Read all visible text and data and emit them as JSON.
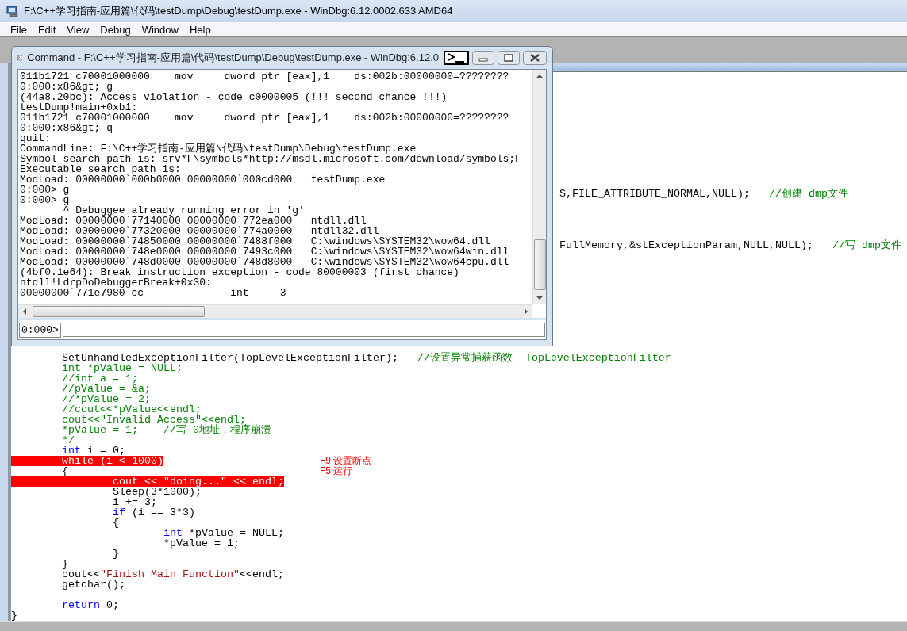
{
  "window": {
    "title": "F:\\C++学习指南-应用篇\\代码\\testDump\\Debug\\testDump.exe - WinDbg:6.12.0002.633 AMD64"
  },
  "menu": [
    "File",
    "Edit",
    "View",
    "Debug",
    "Window",
    "Help"
  ],
  "source": {
    "fragments": [
      {
        "segments": [
          {
            "kind": "code",
            "text": "S,FILE_ATTRIBUTE_NORMAL,NULL);   "
          },
          {
            "kind": "comment",
            "text": "//创建 dmp文件"
          }
        ]
      },
      {
        "segments": [
          {
            "kind": "code",
            "text": "FullMemory,&stExceptionParam,NULL,NULL);   "
          },
          {
            "kind": "comment",
            "text": "//写 dmp文件"
          }
        ]
      }
    ],
    "lines": [
      {
        "segments": [
          {
            "kind": "code",
            "text": "        SetUnhandledExceptionFilter(TopLevelExceptionFilter);   "
          },
          {
            "kind": "comment",
            "text": "//设置异常捕获函数  TopLevelExceptionFilter"
          }
        ],
        "breakpoint": false
      },
      {
        "segments": [
          {
            "kind": "comment",
            "text": "        int *pValue = NULL;"
          }
        ],
        "breakpoint": false
      },
      {
        "segments": [
          {
            "kind": "comment",
            "text": "        //int a = 1;"
          }
        ],
        "breakpoint": false
      },
      {
        "segments": [
          {
            "kind": "comment",
            "text": "        //pValue = &a;"
          }
        ],
        "breakpoint": false
      },
      {
        "segments": [
          {
            "kind": "comment",
            "text": "        //*pValue = 2;"
          }
        ],
        "breakpoint": false
      },
      {
        "segments": [
          {
            "kind": "comment",
            "text": "        //cout<<*pValue<<endl;"
          }
        ],
        "breakpoint": false
      },
      {
        "segments": [
          {
            "kind": "comment",
            "text": "        cout<<\"Invalid Access\"<<endl;"
          }
        ],
        "breakpoint": false
      },
      {
        "segments": [
          {
            "kind": "comment",
            "text": "        *pValue = 1;    //写 0地址，程序崩溃"
          }
        ],
        "breakpoint": false
      },
      {
        "segments": [
          {
            "kind": "comment",
            "text": "        */"
          }
        ],
        "breakpoint": false
      },
      {
        "segments": [
          {
            "kind": "keyword",
            "text": "        int"
          },
          {
            "kind": "code",
            "text": " i = 0;"
          }
        ],
        "breakpoint": false
      },
      {
        "segments": [
          {
            "kind": "code",
            "text": "        while (i < 1000)"
          }
        ],
        "breakpoint": true,
        "note": "F9 设置断点"
      },
      {
        "segments": [
          {
            "kind": "code",
            "text": "        {"
          }
        ],
        "breakpoint": false,
        "note": "F5 运行"
      },
      {
        "segments": [
          {
            "kind": "code",
            "text": "                cout << \"doing...\" << endl;"
          }
        ],
        "breakpoint": true
      },
      {
        "segments": [
          {
            "kind": "code",
            "text": "                Sleep(3*1000);"
          }
        ],
        "breakpoint": false
      },
      {
        "segments": [
          {
            "kind": "code",
            "text": "                i += 3;"
          }
        ],
        "breakpoint": false
      },
      {
        "segments": [
          {
            "kind": "keyword",
            "text": "                if"
          },
          {
            "kind": "code",
            "text": " (i == 3*3)"
          }
        ],
        "breakpoint": false
      },
      {
        "segments": [
          {
            "kind": "code",
            "text": "                {"
          }
        ],
        "breakpoint": false
      },
      {
        "segments": [
          {
            "kind": "keyword",
            "text": "                        int"
          },
          {
            "kind": "code",
            "text": " *pValue = NULL;"
          }
        ],
        "breakpoint": false
      },
      {
        "segments": [
          {
            "kind": "code",
            "text": "                        *pValue = 1;"
          }
        ],
        "breakpoint": false
      },
      {
        "segments": [
          {
            "kind": "code",
            "text": "                }"
          }
        ],
        "breakpoint": false
      },
      {
        "segments": [
          {
            "kind": "code",
            "text": "        }"
          }
        ],
        "breakpoint": false
      },
      {
        "segments": [
          {
            "kind": "code",
            "text": "        cout<<"
          },
          {
            "kind": "string",
            "text": "\"Finish Main Function\""
          },
          {
            "kind": "code",
            "text": "<<endl;"
          }
        ],
        "breakpoint": false
      },
      {
        "segments": [
          {
            "kind": "code",
            "text": "        getchar();"
          }
        ],
        "breakpoint": false
      },
      {
        "breakpoint": false
      },
      {
        "segments": [
          {
            "kind": "keyword",
            "text": "        return"
          },
          {
            "kind": "code",
            "text": " 0;"
          }
        ],
        "breakpoint": false
      },
      {
        "segments": [
          {
            "kind": "code",
            "text": "}"
          }
        ],
        "breakpoint": false
      }
    ]
  },
  "command_window": {
    "title": "Command - F:\\C++学习指南-应用篇\\代码\\testDump\\Debug\\testDump.exe - WinDbg:6.12.0",
    "output": [
      "011b1721 c70001000000    mov     dword ptr [eax],1    ds:002b:00000000=????????",
      "0:000:x86&gt; g",
      "(44a8.20bc): Access violation - code c0000005 (!!! second chance !!!)",
      "testDump!main+0xb1:",
      "011b1721 c70001000000    mov     dword ptr [eax],1    ds:002b:00000000=????????",
      "0:000:x86&gt; q",
      "quit:",
      "CommandLine: F:\\C++学习指南-应用篇\\代码\\testDump\\Debug\\testDump.exe",
      "Symbol search path is: srv*F\\symbols*http://msdl.microsoft.com/download/symbols;F",
      "Executable search path is:",
      "ModLoad: 00000000`000b0000 00000000`000cd000   testDump.exe",
      "0:000> g",
      "0:000> g",
      "       ^ Debuggee already running error in 'g'",
      "ModLoad: 00000000`77140000 00000000`772ea000   ntdll.dll",
      "ModLoad: 00000000`77320000 00000000`774a0000   ntdll32.dll",
      "ModLoad: 00000000`74850000 00000000`7488f000   C:\\windows\\SYSTEM32\\wow64.dll",
      "ModLoad: 00000000`748e0000 00000000`7493c000   C:\\windows\\SYSTEM32\\wow64win.dll",
      "ModLoad: 00000000`748d0000 00000000`748d8000   C:\\windows\\SYSTEM32\\wow64cpu.dll",
      "(4bf0.1e64): Break instruction exception - code 80000003 (first chance)",
      "ntdll!LdrpDoDebuggerBreak+0x30:",
      "00000000`771e7980 cc              int     3"
    ],
    "prompt": "0:000>"
  }
}
